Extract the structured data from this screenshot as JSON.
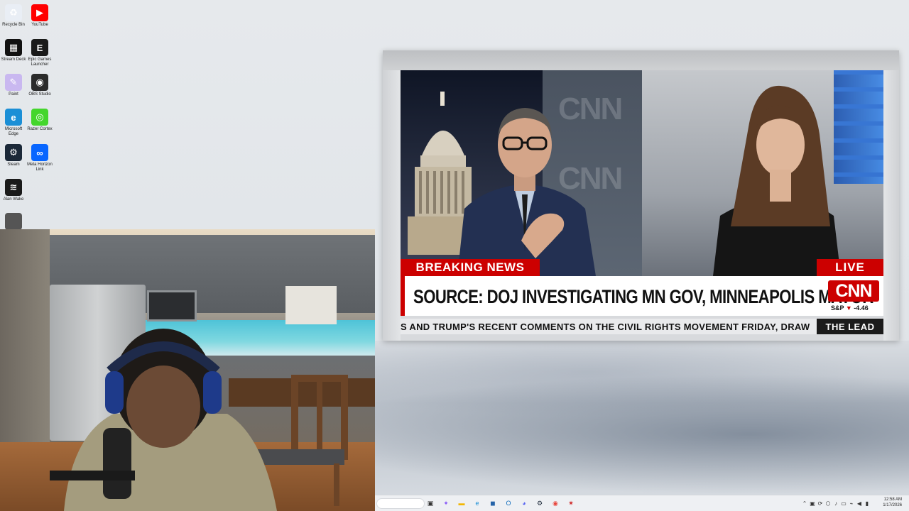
{
  "desktop": {
    "icons": [
      {
        "name": "recycle-bin-icon",
        "label": "Recycle Bin",
        "glyph": "♻",
        "color": "#e9eef5"
      },
      {
        "name": "youtube-icon",
        "label": "YouTube",
        "glyph": "▶",
        "color": "#ff0000"
      },
      {
        "name": "streamdeck-icon",
        "label": "Stream Deck",
        "glyph": "▦",
        "color": "#111111"
      },
      {
        "name": "epic-games-icon",
        "label": "Epic Games Launcher",
        "glyph": "E",
        "color": "#1a1a1a"
      },
      {
        "name": "paint-icon",
        "label": "Paint",
        "glyph": "✎",
        "color": "#c9b8f0"
      },
      {
        "name": "obs-studio-icon",
        "label": "OBS Studio",
        "glyph": "◉",
        "color": "#2b2b2b"
      },
      {
        "name": "microsoft-edge-icon",
        "label": "Microsoft Edge",
        "glyph": "e",
        "color": "#1b8fd6"
      },
      {
        "name": "razer-cortex-icon",
        "label": "Razer Cortex",
        "glyph": "◎",
        "color": "#44d62c"
      },
      {
        "name": "steam-icon",
        "label": "Steam",
        "glyph": "⚙",
        "color": "#1b2838"
      },
      {
        "name": "meta-horizon-icon",
        "label": "Meta Horizon Link",
        "glyph": "∞",
        "color": "#0866ff"
      },
      {
        "name": "game-shortcut-icon",
        "label": "Alan Wake",
        "glyph": "≋",
        "color": "#1a1a1a"
      }
    ]
  },
  "video": {
    "breaking_label": "BREAKING NEWS",
    "live_label": "LIVE",
    "headline": "SOURCE: DOJ INVESTIGATING MN GOV, MINNEAPOLIS MAYOR",
    "network_logo": "CNN",
    "ticker_symbol": "S&P",
    "ticker_arrow": "▼",
    "ticker_change": "-4.46",
    "crawl": "S AND TRUMP'S RECENT COMMENTS ON THE CIVIL RIGHTS MOVEMENT FRIDAY, DRAW",
    "show_name": "THE LEAD",
    "wall_text": "CNN"
  },
  "taskbar": {
    "clock_time": "12:58 AM",
    "clock_date": "1/17/2026",
    "pinned": [
      {
        "name": "task-view-icon",
        "glyph": "▣",
        "color": "#333333"
      },
      {
        "name": "copilot-icon",
        "glyph": "✦",
        "color": "#8a5cf6"
      },
      {
        "name": "file-explorer-icon",
        "glyph": "▬",
        "color": "#f2b705"
      },
      {
        "name": "edge-taskbar-icon",
        "glyph": "e",
        "color": "#1b8fd6"
      },
      {
        "name": "store-icon",
        "glyph": "◼",
        "color": "#2563a8"
      },
      {
        "name": "outlook-icon",
        "glyph": "O",
        "color": "#0f6cbd"
      },
      {
        "name": "discord-icon",
        "glyph": "◕",
        "color": "#5865f2"
      },
      {
        "name": "steam-taskbar-icon",
        "glyph": "⚙",
        "color": "#1b2838"
      },
      {
        "name": "chrome-icon",
        "glyph": "◉",
        "color": "#e8453c"
      },
      {
        "name": "app-taskbar-icon",
        "glyph": "✷",
        "color": "#d03030"
      }
    ],
    "tray": [
      {
        "name": "tray-overflow-icon",
        "glyph": "⌃"
      },
      {
        "name": "tray-app-icon",
        "glyph": "▣"
      },
      {
        "name": "tray-sync-icon",
        "glyph": "⟳"
      },
      {
        "name": "tray-drive-icon",
        "glyph": "⬡"
      },
      {
        "name": "tray-mic-icon",
        "glyph": "♪"
      },
      {
        "name": "tray-monitor-icon",
        "glyph": "▭"
      },
      {
        "name": "tray-network-icon",
        "glyph": "⌁"
      },
      {
        "name": "tray-volume-icon",
        "glyph": "◀"
      },
      {
        "name": "tray-battery-icon",
        "glyph": "▮"
      }
    ]
  }
}
